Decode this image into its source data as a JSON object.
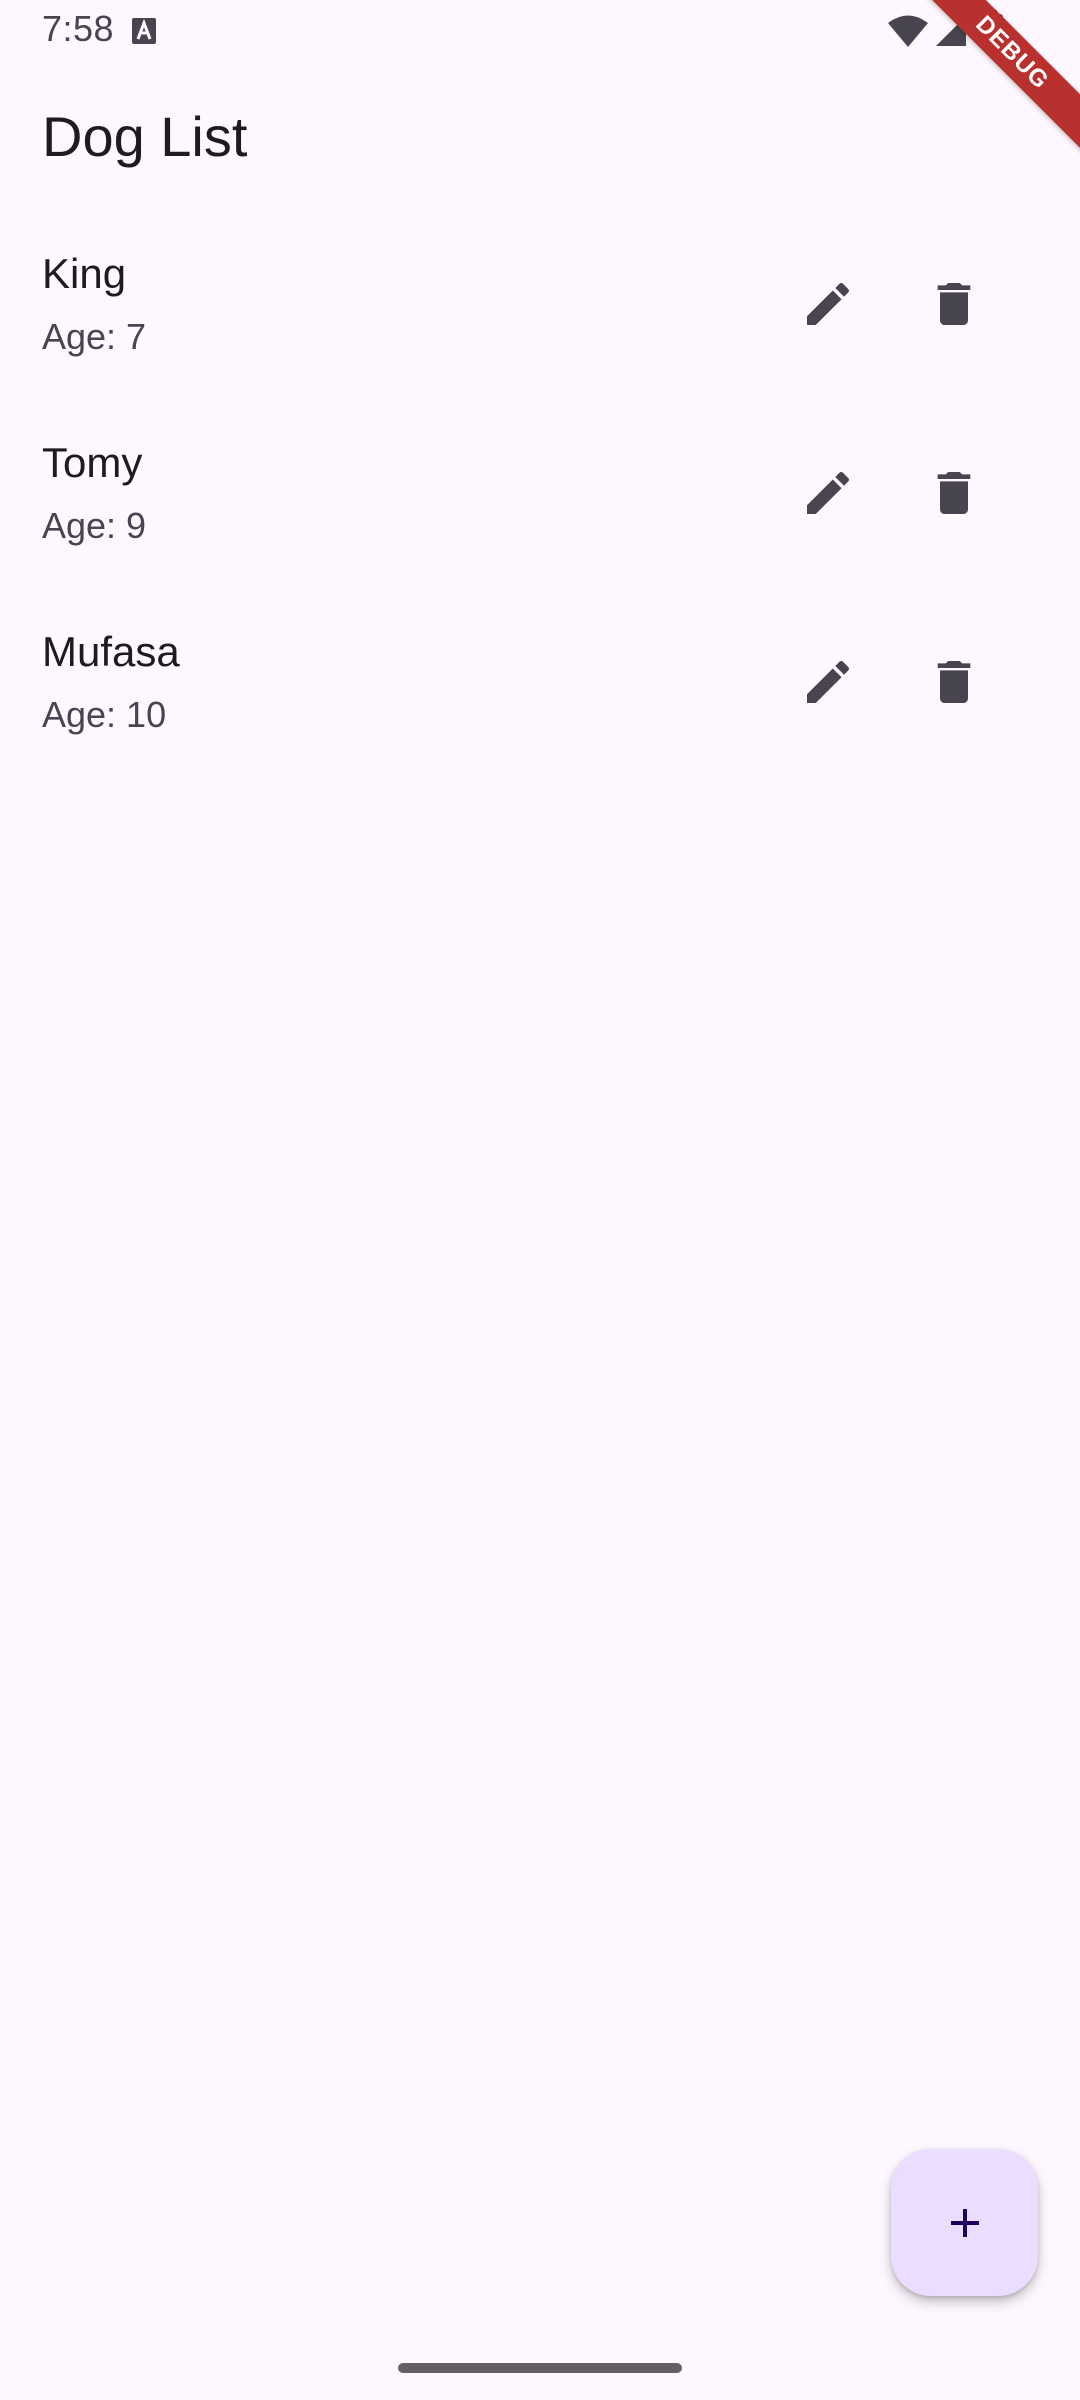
{
  "status_bar": {
    "time": "7:58",
    "icons": [
      "notification-a-icon",
      "wifi-icon",
      "signal-icon",
      "battery-icon"
    ]
  },
  "debug_banner": {
    "label": "DEBUG",
    "color": "#B8312F"
  },
  "app_bar": {
    "title": "Dog List"
  },
  "dogs": [
    {
      "name": "King",
      "age": "Age: 7",
      "edit_icon": "edit-icon",
      "delete_icon": "delete-icon"
    },
    {
      "name": "Tomy",
      "age": "Age: 9",
      "edit_icon": "edit-icon",
      "delete_icon": "delete-icon"
    },
    {
      "name": "Mufasa",
      "age": "Age: 10",
      "edit_icon": "edit-icon",
      "delete_icon": "delete-icon"
    }
  ],
  "fab": {
    "icon": "add-icon",
    "background": "#EADDFF"
  },
  "colors": {
    "background": "#FEF7FF",
    "on_surface": "#1D1B20",
    "on_surface_variant": "#49454F"
  }
}
